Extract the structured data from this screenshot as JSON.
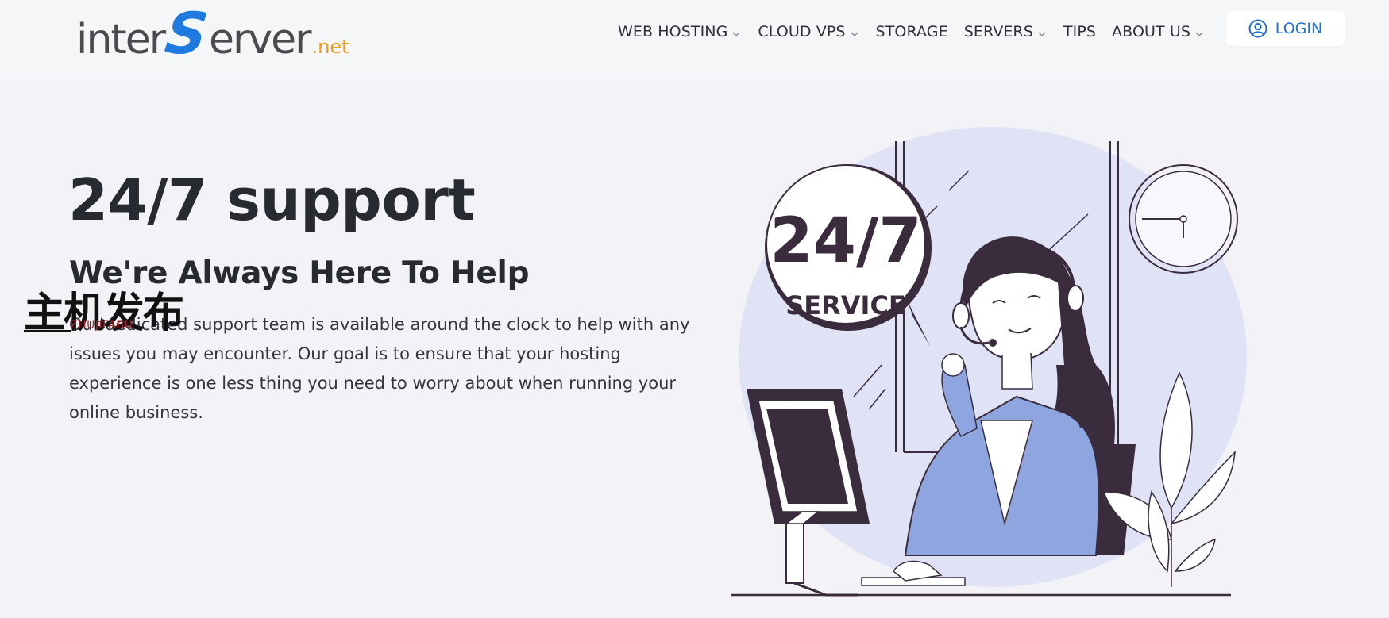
{
  "brand": {
    "logo_prefix": "inter",
    "logo_s": "S",
    "logo_suffix": "erver",
    "logo_tld": ".net",
    "colors": {
      "grey": "#4a4a4f",
      "blue": "#1f7ae0",
      "orange": "#f39c1a"
    }
  },
  "nav": {
    "items": [
      {
        "label": "WEB HOSTING",
        "has_dropdown": true
      },
      {
        "label": "CLOUD VPS",
        "has_dropdown": true
      },
      {
        "label": "STORAGE",
        "has_dropdown": false
      },
      {
        "label": "SERVERS",
        "has_dropdown": true
      },
      {
        "label": "TIPS",
        "has_dropdown": false
      },
      {
        "label": "ABOUT US",
        "has_dropdown": true
      }
    ],
    "login_label": "LOGIN",
    "login_icon": "user-circle-icon",
    "accent": "#1f6fd6"
  },
  "hero": {
    "title": "24/7 support",
    "subtitle": "We're Always Here To Help",
    "body": "Our dedicated support team is available around the clock to help with any issues you may encounter. Our goal is to ensure that your hosting experience is one less thing you need to worry about when running your online business."
  },
  "illustration": {
    "badge_big": "24/7",
    "badge_small": "SERVICE",
    "blob_color": "#dfe3f5",
    "jacket_color": "#8fa5e0",
    "dark_color": "#3a2c3d"
  },
  "watermark": {
    "cn": "主机发布",
    "en": "ZHUJIFABU"
  }
}
